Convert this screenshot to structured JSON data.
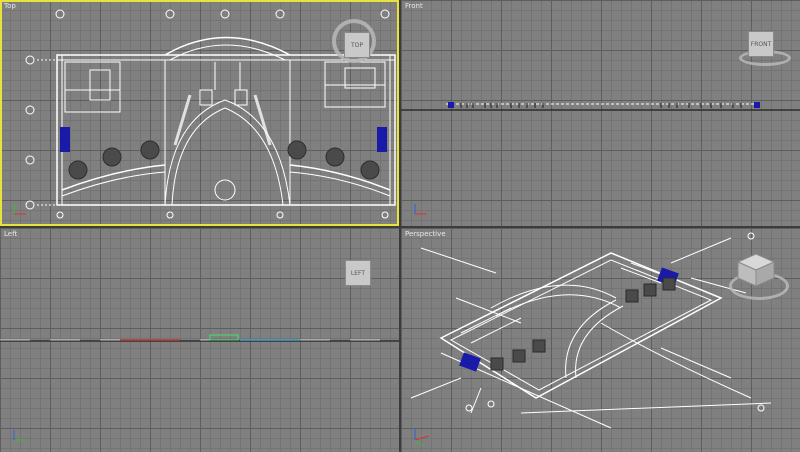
{
  "viewports": {
    "top": {
      "label": "Top",
      "cube_label": "TOP"
    },
    "front": {
      "label": "Front",
      "cube_label": "FRONT"
    },
    "left": {
      "label": "Left",
      "cube_label": "LEFT"
    },
    "perspective": {
      "label": "Perspective"
    }
  },
  "colors": {
    "background": "#808080",
    "grid_minor": "#747474",
    "grid_major": "#5e5e5e",
    "active_border": "#e8e23c",
    "geometry": "#ffffff",
    "selection_blue": "#1a1aa8"
  }
}
